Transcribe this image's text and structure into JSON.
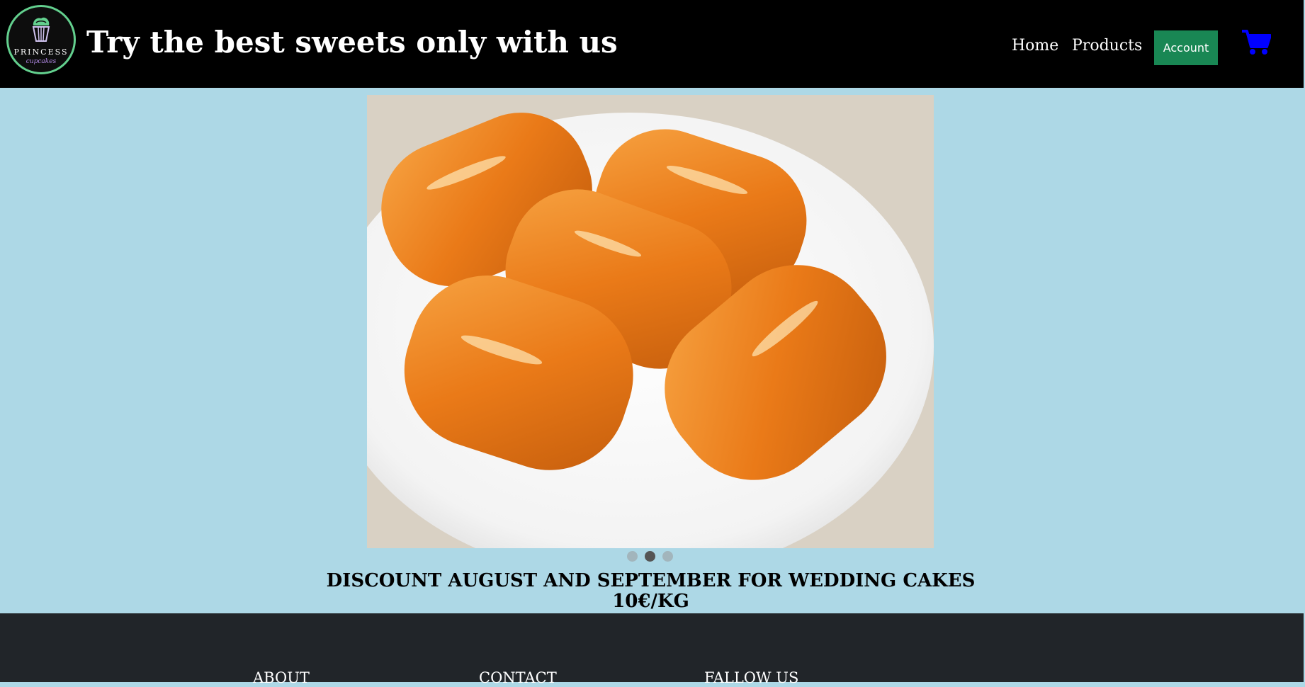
{
  "header": {
    "logo": {
      "name": "PRINCESS",
      "subtitle": "cupcakes",
      "icon": "cupcake-icon"
    },
    "title": "Try the best sweets only with us",
    "nav": {
      "home": "Home",
      "products": "Products"
    },
    "account_label": "Account",
    "cart_icon": "shopping-cart-icon"
  },
  "carousel": {
    "image_alt": "Tulumba sweets on a white plate",
    "slide_count": 3,
    "active_index": 1
  },
  "promo": {
    "line1": "DISCOUNT AUGUST AND SEPTEMBER FOR WEDDING CAKES",
    "line2": "10€/KG"
  },
  "footer": {
    "about": "ABOUT",
    "contact": "CONTACT",
    "follow": "FALLOW US"
  },
  "colors": {
    "header_bg": "#000000",
    "page_bg": "#add8e6",
    "account_btn": "#198754",
    "cart": "#0000ff",
    "footer_bg": "#212529",
    "logo_ring": "#63d08e"
  }
}
